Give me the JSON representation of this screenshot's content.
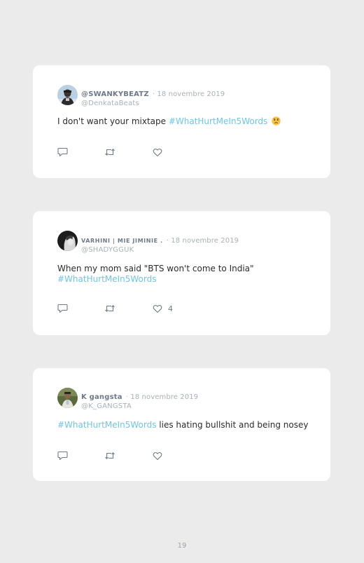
{
  "tweets": [
    {
      "display_name": "@SWANKYBEATZ",
      "date": "· 18 novembre 2019",
      "handle": "@DenkataBeats",
      "text_before": "I don't want your mixtape ",
      "hashtag": "#WhatHurtMeIn5Words",
      "text_after": "",
      "emoji": "worried-face-emoji",
      "like_count": ""
    },
    {
      "display_name": "VARHINI | MIE JIMINIE .",
      "date": "· 18 novembre 2019",
      "handle": "@SHADYGGUK",
      "text_before": "When my mom said \"BTS won't come to India\"",
      "hashtag": "#WhatHurtMeIn5Words",
      "text_after": "",
      "like_count": "4"
    },
    {
      "display_name": "K gangsta",
      "date": "· 18 novembre 2019",
      "handle": "@K_GANGSTA",
      "text_before": "",
      "hashtag": "#WhatHurtMeIn5Words",
      "text_after": " lies hating bullshit and being nosey",
      "like_count": ""
    }
  ],
  "icons": {
    "reply": "reply-icon",
    "retweet": "retweet-icon",
    "like": "heart-icon"
  },
  "colors": {
    "background": "#ebebeb",
    "card": "#ffffff",
    "hashtag": "#6ec5e6",
    "name": "#6e7a87",
    "muted": "#a8b0b8"
  },
  "page_number": "19"
}
